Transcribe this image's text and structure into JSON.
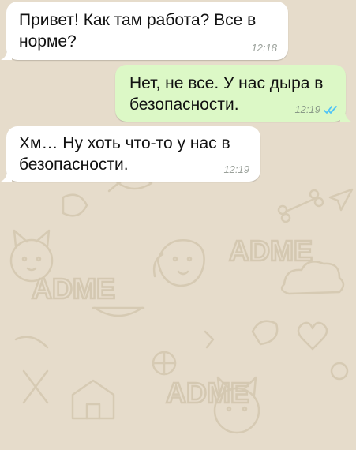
{
  "messages": [
    {
      "direction": "incoming",
      "text": "Привет! Как там работа? Все в норме?",
      "time": "12:18"
    },
    {
      "direction": "outgoing",
      "text": "Нет, не все. У нас дыра в безопасности.",
      "time": "12:19",
      "status": "read"
    },
    {
      "direction": "incoming",
      "text": "Хм… Ну хоть что-то у нас в безопасности.",
      "time": "12:19"
    }
  ],
  "wallpaper": {
    "watermark": "ADME",
    "background_color": "#e6dccb",
    "doodle_color": "#d8cdb8"
  },
  "colors": {
    "incoming_bubble": "#ffffff",
    "outgoing_bubble": "#dcf8c6",
    "read_ticks": "#4fc3f7"
  }
}
